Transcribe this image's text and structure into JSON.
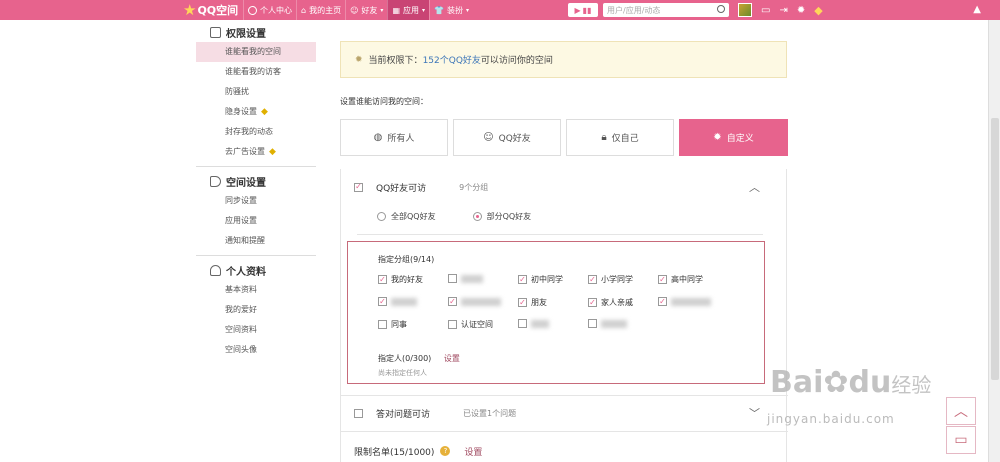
{
  "topbar": {
    "logo": "QQ空间",
    "nav": [
      {
        "label": "个人中心",
        "icon": "user-icon"
      },
      {
        "label": "我的主页",
        "icon": "home-icon"
      },
      {
        "label": "好友",
        "icon": "friends-icon"
      },
      {
        "label": "应用",
        "icon": "apps-icon"
      },
      {
        "label": "装扮",
        "icon": "shirt-icon"
      }
    ],
    "search_placeholder": "用户/应用/动态"
  },
  "sidebar": {
    "sections": [
      {
        "title": "权限设置",
        "icon": "lock-icon",
        "items": [
          "谁能看我的空间",
          "谁能看我的访客",
          "防骚扰",
          "隐身设置",
          "封存我的动态",
          "去广告设置"
        ]
      },
      {
        "title": "空间设置",
        "icon": "megaphone-icon",
        "items": [
          "同步设置",
          "应用设置",
          "通知和提醒"
        ]
      },
      {
        "title": "个人资料",
        "icon": "profile-icon",
        "items": [
          "基本资料",
          "我的爱好",
          "空间资料",
          "空间头像"
        ]
      }
    ]
  },
  "notice": {
    "prefix": "当前权限下：",
    "highlight": "152个QQ好友",
    "suffix": "可以访问你的空间"
  },
  "access_label": "设置谁能访问我的空间：",
  "access_options": [
    {
      "label": "所有人",
      "icon": "globe-icon",
      "selected": false
    },
    {
      "label": "QQ好友",
      "icon": "user-icon",
      "selected": false
    },
    {
      "label": "仅自己",
      "icon": "lock-icon",
      "selected": false
    },
    {
      "label": "自定义",
      "icon": "gear-icon",
      "selected": true
    }
  ],
  "qq_friends": {
    "title": "QQ好友可访",
    "count": "9个分组",
    "radio_all": "全部QQ好友",
    "radio_part": "部分QQ好友",
    "group_title": "指定分组(9/14)",
    "groups": [
      {
        "label": "我的好友",
        "checked": true
      },
      {
        "label": "",
        "checked": false,
        "blurred": true
      },
      {
        "label": "初中同学",
        "checked": true
      },
      {
        "label": "小学同学",
        "checked": true
      },
      {
        "label": "高中同学",
        "checked": true
      },
      {
        "label": "",
        "checked": true,
        "blurred": true
      },
      {
        "label": "",
        "checked": true,
        "blurred": true
      },
      {
        "label": "朋友",
        "checked": true
      },
      {
        "label": "家人亲戚",
        "checked": true
      },
      {
        "label": "",
        "checked": true,
        "blurred": true
      },
      {
        "label": "同事",
        "checked": false
      },
      {
        "label": "认证空间",
        "checked": false
      },
      {
        "label": "",
        "checked": false,
        "blurred": true
      },
      {
        "label": "",
        "checked": false,
        "blurred": true
      }
    ],
    "persons_label": "指定人(0/300)",
    "persons_link": "设置",
    "persons_none": "尚未指定任何人"
  },
  "question": {
    "title": "答对问题可访",
    "status": "已设置1个问题"
  },
  "blacklist": {
    "title": "限制名单(15/1000)",
    "link": "设置"
  },
  "watermark": {
    "brand": "Bai",
    "brand2": "du",
    "brand3": "经验",
    "url": "jingyan.baidu.com"
  }
}
